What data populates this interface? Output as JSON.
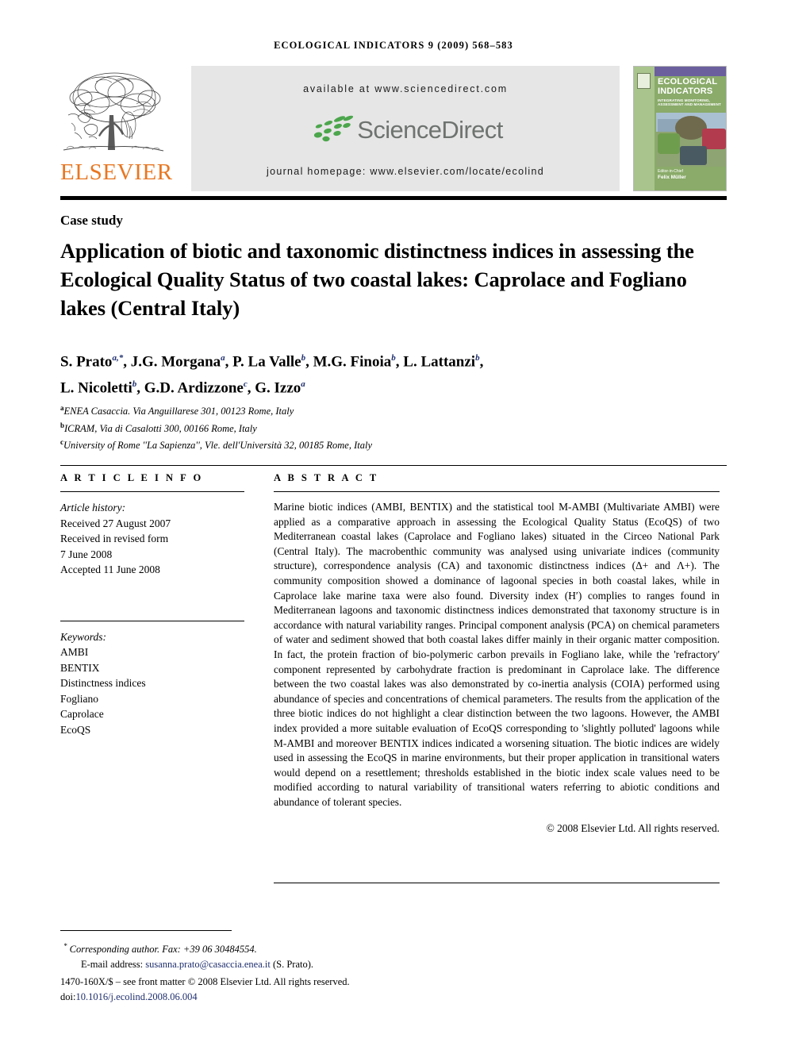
{
  "running_head": "ECOLOGICAL INDICATORS 9 (2009) 568–583",
  "masthead": {
    "publisher_name": "ELSEVIER",
    "publisher_logo_icon": "elsevier-tree-logo",
    "available_at": "available at www.sciencedirect.com",
    "sciencedirect_wordmark": "ScienceDirect",
    "sciencedirect_leaf_icon": "sciencedirect-leaves-icon",
    "journal_homepage": "journal homepage: www.elsevier.com/locate/ecolind",
    "cover": {
      "title": "ECOLOGICAL INDICATORS",
      "subtitle": "INTEGRATING MONITORING, ASSESSMENT AND MANAGEMENT",
      "editor_label": "Editor-in-Chief",
      "editor_name": "Felix Müller",
      "spine_color": "#a9c48c",
      "band_color": "#6b5f9e",
      "body_color": "#8aab6a"
    }
  },
  "article": {
    "type": "Case study",
    "title": "Application of biotic and taxonomic distinctness indices in assessing the Ecological Quality Status of two coastal lakes: Caprolace and Fogliano lakes (Central Italy)",
    "authors_line1": "S. Prato",
    "authors_html_l1_sup1": "a,*",
    "authors": [
      {
        "name": "S. Prato",
        "sup": "a,*"
      },
      {
        "name": "J.G. Morgana",
        "sup": "a"
      },
      {
        "name": "P. La Valle",
        "sup": "b"
      },
      {
        "name": "M.G. Finoia",
        "sup": "b"
      },
      {
        "name": "L. Lattanzi",
        "sup": "b"
      },
      {
        "name": "L. Nicoletti",
        "sup": "b"
      },
      {
        "name": "G.D. Ardizzone",
        "sup": "c"
      },
      {
        "name": "G. Izzo",
        "sup": "a"
      }
    ],
    "affiliations": [
      {
        "mark": "a",
        "text": "ENEA Casaccia. Via Anguillarese 301, 00123 Rome, Italy"
      },
      {
        "mark": "b",
        "text": "ICRAM, Via di Casalotti 300, 00166 Rome, Italy"
      },
      {
        "mark": "c",
        "text": "University of Rome ''La Sapienza'', Vle. dell'Università 32, 00185 Rome, Italy"
      }
    ]
  },
  "article_info": {
    "heading": "A R T I C L E   I N F O",
    "history_label": "Article history:",
    "history": [
      "Received 27 August 2007",
      "Received in revised form",
      "7 June 2008",
      "Accepted 11 June 2008"
    ],
    "keywords_label": "Keywords:",
    "keywords": [
      "AMBI",
      "BENTIX",
      "Distinctness indices",
      "Fogliano",
      "Caprolace",
      "EcoQS"
    ]
  },
  "abstract": {
    "heading": "A B S T R A C T",
    "text": "Marine biotic indices (AMBI, BENTIX) and the statistical tool M-AMBI (Multivariate AMBI) were applied as a comparative approach in assessing the Ecological Quality Status (EcoQS) of two Mediterranean coastal lakes (Caprolace and Fogliano lakes) situated in the Circeo National Park (Central Italy). The macrobenthic community was analysed using univariate indices (community structure), correspondence analysis (CA) and taxonomic distinctness indices (Δ+ and Λ+). The community composition showed a dominance of lagoonal species in both coastal lakes, while in Caprolace lake marine taxa were also found. Diversity index (H′) complies to ranges found in Mediterranean lagoons and taxonomic distinctness indices demonstrated that taxonomy structure is in accordance with natural variability ranges. Principal component analysis (PCA) on chemical parameters of water and sediment showed that both coastal lakes differ mainly in their organic matter composition. In fact, the protein fraction of bio-polymeric carbon prevails in Fogliano lake, while the 'refractory' component represented by carbohydrate fraction is predominant in Caprolace lake. The difference between the two coastal lakes was also demonstrated by co-inertia analysis (COIA) performed using abundance of species and concentrations of chemical parameters. The results from the application of the three biotic indices do not highlight a clear distinction between the two lagoons. However, the AMBI index provided a more suitable evaluation of EcoQS corresponding to 'slightly polluted' lagoons while M-AMBI and moreover BENTIX indices indicated a worsening situation. The biotic indices are widely used in assessing the EcoQS in marine environments, but their proper application in transitional waters would depend on a resettlement; thresholds established in the biotic index scale values need to be modified according to natural variability of transitional waters referring to abiotic conditions and abundance of tolerant species.",
    "copyright": "© 2008 Elsevier Ltd. All rights reserved."
  },
  "footnotes": {
    "corresponding": "Corresponding author. Fax: +39 06 30484554.",
    "email_label": "E-mail address:",
    "email": "susanna.prato@casaccia.enea.it",
    "email_owner": "(S. Prato).",
    "front_matter": "1470-160X/$ – see front matter © 2008 Elsevier Ltd. All rights reserved.",
    "doi_label": "doi:",
    "doi": "10.1016/j.ecolind.2008.06.004",
    "link_color": "#1f2f6e"
  }
}
